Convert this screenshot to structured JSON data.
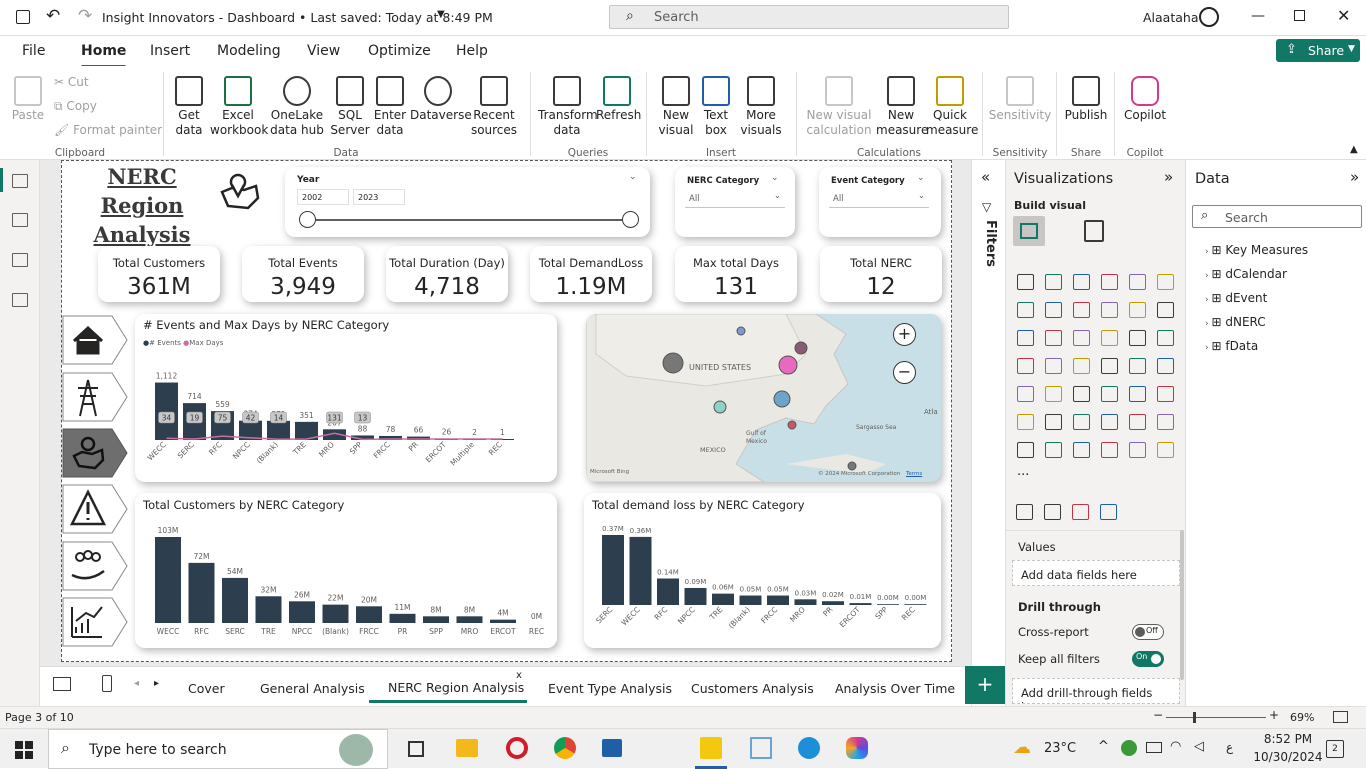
{
  "titlebar": {
    "title": "Insight Innovators - Dashboard • Last saved: Today at 8:49 PM",
    "search_placeholder": "Search",
    "user": "Alaataha"
  },
  "menu": [
    "File",
    "Home",
    "Insert",
    "Modeling",
    "View",
    "Optimize",
    "Help"
  ],
  "share_label": "Share",
  "ribbon": {
    "clipboard": {
      "paste": "Paste",
      "cut": "Cut",
      "copy": "Copy",
      "format_painter": "Format painter",
      "group": "Clipboard"
    },
    "data": {
      "get_data": "Get data",
      "excel": "Excel workbook",
      "onelake": "OneLake data hub",
      "sql": "SQL Server",
      "enter": "Enter data",
      "dataverse": "Dataverse",
      "recent": "Recent sources",
      "group": "Data"
    },
    "queries": {
      "transform": "Transform data",
      "refresh": "Refresh",
      "group": "Queries"
    },
    "insert": {
      "new_visual": "New visual",
      "text_box": "Text box",
      "more_visuals": "More visuals",
      "group": "Insert"
    },
    "calculations": {
      "new_visual_calc": "New visual calculation",
      "new_measure": "New measure",
      "quick_measure": "Quick measure",
      "group": "Calculations"
    },
    "sensitivity": {
      "label": "Sensitivity",
      "group": "Sensitivity"
    },
    "share": {
      "publish": "Publish",
      "group": "Share"
    },
    "copilot": {
      "label": "Copilot",
      "group": "Copilot"
    }
  },
  "report": {
    "title_line1": "NERC Region",
    "title_line2": "Analysis",
    "year_slicer": {
      "label": "Year",
      "from": "2002",
      "to": "2023"
    },
    "nerc_slicer": {
      "label": "NERC Category",
      "value": "All"
    },
    "event_slicer": {
      "label": "Event Category",
      "value": "All"
    },
    "kpis": [
      {
        "label": "Total Customers",
        "value": "361M"
      },
      {
        "label": "Total Events",
        "value": "3,949"
      },
      {
        "label": "Total Duration (Day)",
        "value": "4,718"
      },
      {
        "label": "Total DemandLoss",
        "value": "1.19M"
      },
      {
        "label": "Max total Days",
        "value": "131"
      },
      {
        "label": "Total NERC",
        "value": "12"
      }
    ],
    "map": {
      "label": "UNITED STATES",
      "gulf": "Gulf of Mexico",
      "mexico": "MEXICO",
      "sargasso": "Sargasso Sea",
      "atl": "Atla",
      "bing": "Microsoft Bing",
      "copyright": "© 2024 Microsoft Corporation",
      "terms": "Terms"
    }
  },
  "chart_data": [
    {
      "type": "bar",
      "title": "# Events and Max Days by NERC Category",
      "legend": [
        "# Events",
        "Max Days"
      ],
      "categories": [
        "WECC",
        "SERC",
        "RFC",
        "NPCC",
        "(Blank)",
        "TRE",
        "MRO",
        "SPP",
        "FRCC",
        "PR",
        "ERCOT",
        "Multiple",
        "REC"
      ],
      "series": [
        {
          "name": "# Events",
          "values": [
            1112,
            714,
            559,
            374,
            371,
            351,
            207,
            88,
            78,
            66,
            26,
            2,
            1
          ],
          "labels": [
            "1,112",
            "714",
            "559",
            "374",
            "371",
            "351",
            "207",
            "88",
            "78",
            "66",
            "26",
            "2",
            "1"
          ]
        },
        {
          "name": "Max Days",
          "values": [
            34,
            19,
            75,
            42,
            14,
            null,
            131,
            13,
            null,
            null,
            null,
            null,
            null
          ],
          "labels": [
            "34",
            "19",
            "75",
            "42",
            "14",
            "",
            "131",
            "13",
            "",
            "",
            "",
            "",
            ""
          ]
        }
      ]
    },
    {
      "type": "bar",
      "title": "Total Customers by NERC Category",
      "categories": [
        "WECC",
        "RFC",
        "SERC",
        "TRE",
        "NPCC",
        "(Blank)",
        "FRCC",
        "PR",
        "SPP",
        "MRO",
        "ERCOT",
        "REC"
      ],
      "values": [
        103,
        72,
        54,
        32,
        26,
        22,
        20,
        11,
        8,
        8,
        4,
        0
      ],
      "labels": [
        "103M",
        "72M",
        "54M",
        "32M",
        "26M",
        "22M",
        "20M",
        "11M",
        "8M",
        "8M",
        "4M",
        "0M"
      ]
    },
    {
      "type": "bar",
      "title": "Total demand loss by NERC Category",
      "categories": [
        "SERC",
        "WECC",
        "RFC",
        "NPCC",
        "TRE",
        "(Blank)",
        "FRCC",
        "MRO",
        "PR",
        "ERCOT",
        "SPP",
        "REC"
      ],
      "values": [
        0.37,
        0.36,
        0.14,
        0.09,
        0.06,
        0.05,
        0.05,
        0.03,
        0.02,
        0.01,
        0.0,
        0.0
      ],
      "labels": [
        "0.37M",
        "0.36M",
        "0.14M",
        "0.09M",
        "0.06M",
        "0.05M",
        "0.05M",
        "0.03M",
        "0.02M",
        "0.01M",
        "0.00M",
        "0.00M"
      ]
    }
  ],
  "filters_label": "Filters",
  "viz": {
    "title": "Visualizations",
    "build": "Build visual",
    "values": "Values",
    "add_data": "Add data fields here",
    "drill": "Drill through",
    "cross": "Cross-report",
    "cross_state": "Off",
    "keep": "Keep all filters",
    "keep_state": "On",
    "add_drill": "Add drill-through fields here"
  },
  "data_pane": {
    "title": "Data",
    "search": "Search",
    "items": [
      "Key Measures",
      "dCalendar",
      "dEvent",
      "dNERC",
      "fData"
    ]
  },
  "tabs": [
    "Cover",
    "General Analysis",
    "NERC Region Analysis",
    "Event Type Analysis",
    "Customers Analysis",
    "Analysis Over Time"
  ],
  "status": {
    "page": "Page 3 of 10",
    "zoom": "69%"
  },
  "taskbar": {
    "search": "Type here to search",
    "temp": "23°C",
    "time": "8:52 PM",
    "date": "10/30/2024",
    "lang": "ع",
    "notif": "2"
  },
  "colors": {
    "accent": "#117865",
    "bar": "#2d3e4e",
    "maxdays": "#c86fa0"
  }
}
